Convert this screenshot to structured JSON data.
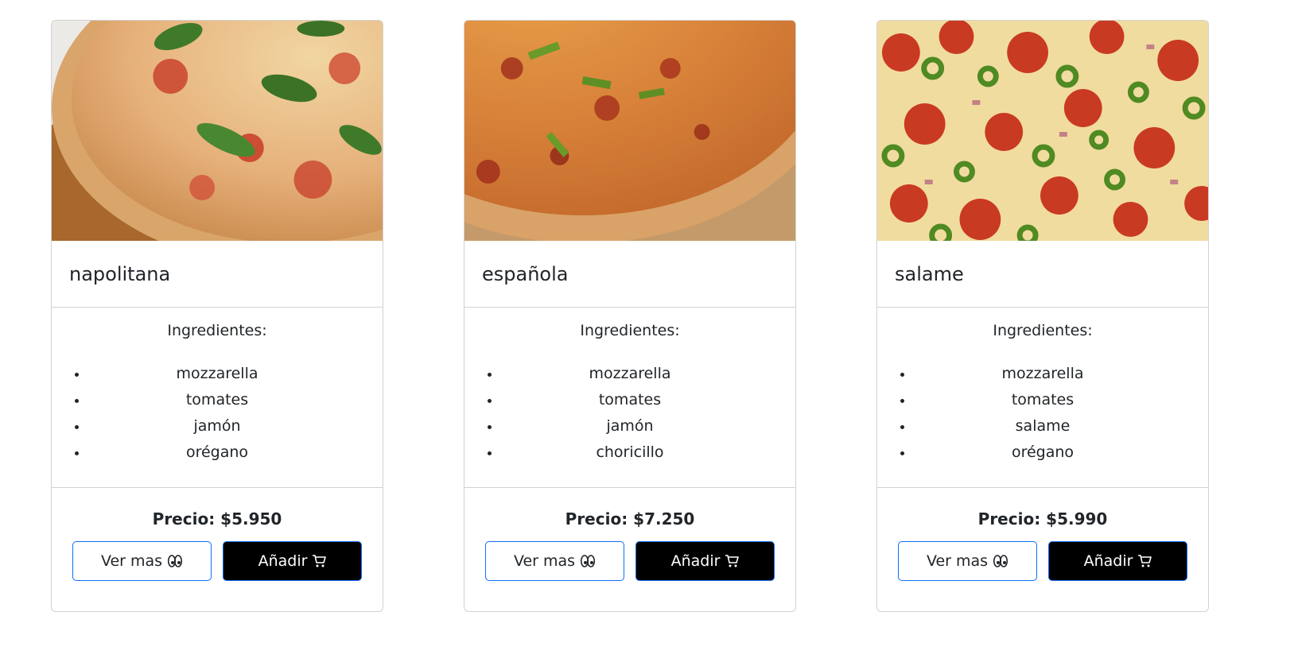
{
  "cards": [
    {
      "name": "napolitana",
      "ingredients_title": "Ingredientes:",
      "ingredients": [
        "mozzarella",
        "tomates",
        "jamón",
        "orégano"
      ],
      "price": "Precio: $5.950",
      "view_label": "Ver mas",
      "add_label": "Añadir",
      "view_icon": "eyes-icon",
      "add_icon": "cart-icon"
    },
    {
      "name": "española",
      "ingredients_title": "Ingredientes:",
      "ingredients": [
        "mozzarella",
        "tomates",
        "jamón",
        "choricillo"
      ],
      "price": "Precio: $7.250",
      "view_label": "Ver mas",
      "add_label": "Añadir",
      "view_icon": "eyes-icon",
      "add_icon": "cart-icon"
    },
    {
      "name": "salame",
      "ingredients_title": "Ingredientes:",
      "ingredients": [
        "mozzarella",
        "tomates",
        "salame",
        "orégano"
      ],
      "price": "Precio: $5.990",
      "view_label": "Ver mas",
      "add_label": "Añadir",
      "view_icon": "eyes-icon",
      "add_icon": "cart-icon"
    }
  ],
  "colors": {
    "button_border": "#0d6efd",
    "add_button_bg": "#000000",
    "card_border": "#dee2e6"
  }
}
